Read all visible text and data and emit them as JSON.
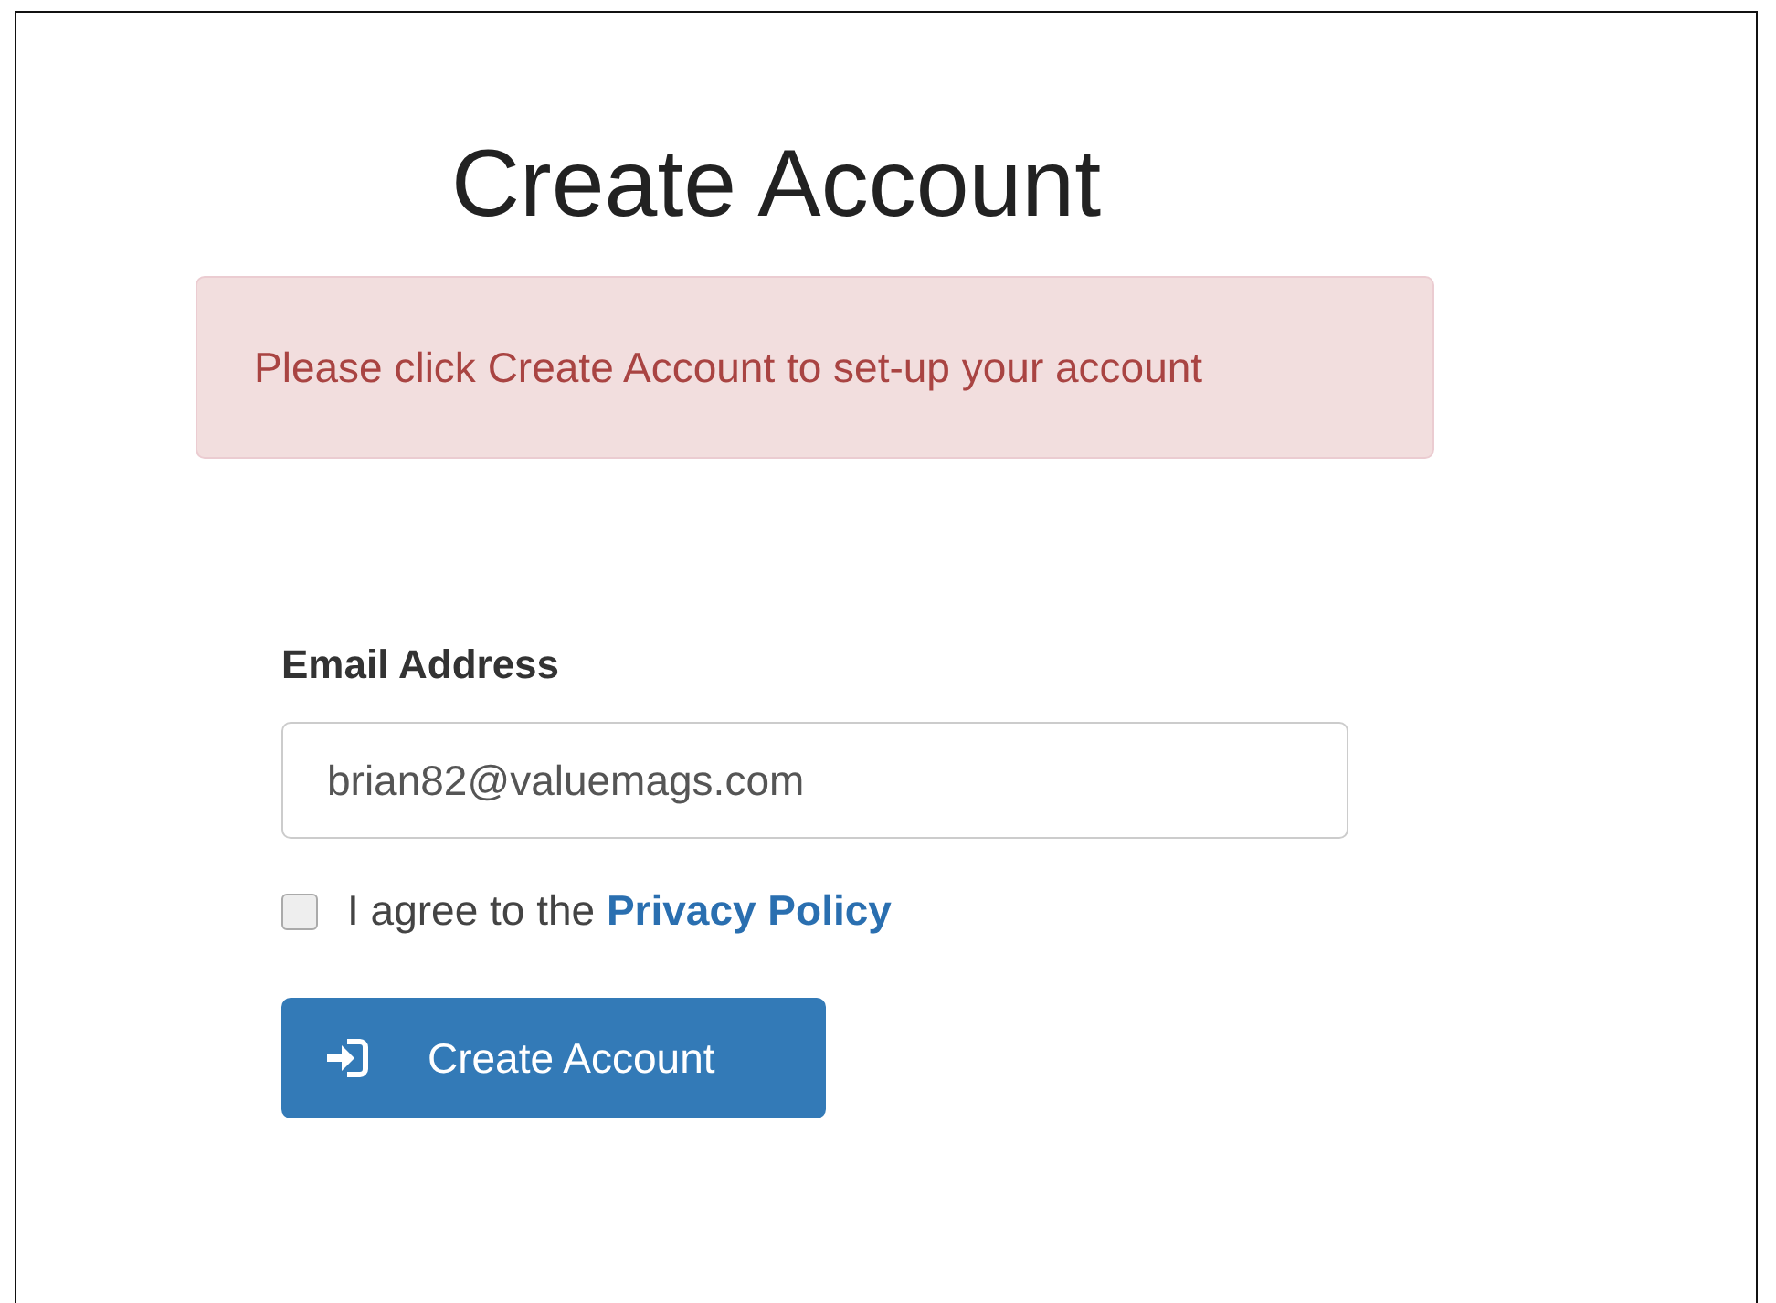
{
  "title": "Create Account",
  "alert": {
    "message": "Please click Create Account to set-up your account"
  },
  "form": {
    "email_label": "Email Address",
    "email_value": "brian82@valuemags.com",
    "agreement": {
      "text": "I agree to the",
      "link": "Privacy Policy",
      "checked": false
    },
    "submit": {
      "label": "Create Account"
    }
  }
}
